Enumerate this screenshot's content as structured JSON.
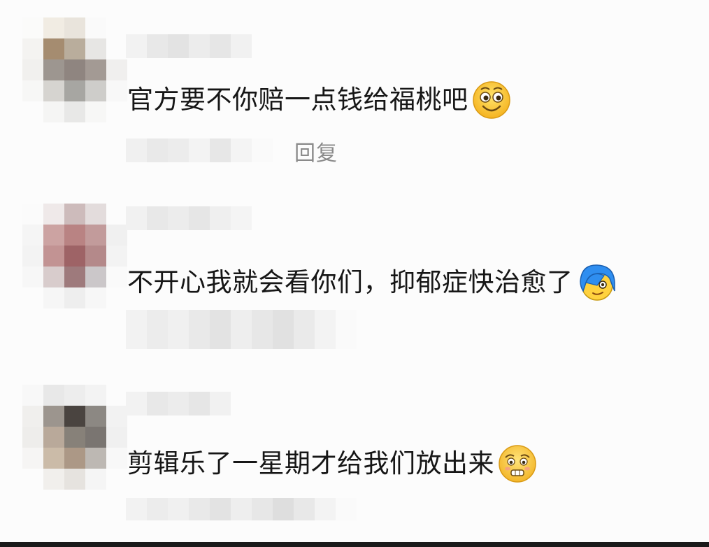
{
  "comments": [
    {
      "text": "官方要不你赔一点钱给福桃吧",
      "emoji": "grinning-face-icon"
    },
    {
      "text": "不开心我就会看你们，抑郁症快治愈了",
      "emoji": "blue-hair-face-icon"
    },
    {
      "text": "剪辑乐了一星期才给我们放出来",
      "emoji": "pleading-face-icon"
    }
  ],
  "reply_label": "回复"
}
